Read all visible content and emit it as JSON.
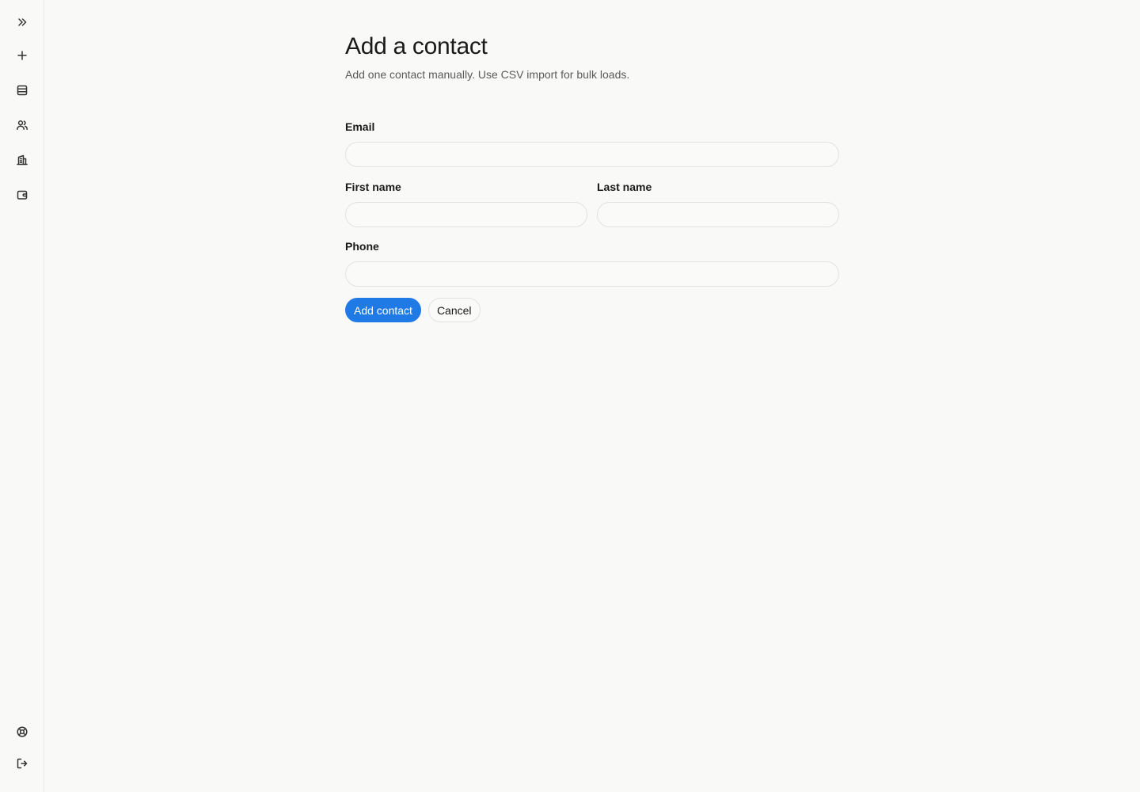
{
  "sidebar": {
    "top_items": [
      {
        "name": "expand-sidebar",
        "icon": "chevrons-right-icon"
      },
      {
        "name": "new",
        "icon": "plus-icon"
      },
      {
        "name": "lists",
        "icon": "table-icon"
      },
      {
        "name": "contacts",
        "icon": "users-icon"
      },
      {
        "name": "companies",
        "icon": "building-icon"
      },
      {
        "name": "wallet",
        "icon": "wallet-icon"
      }
    ],
    "bottom_items": [
      {
        "name": "help",
        "icon": "lifebuoy-icon"
      },
      {
        "name": "logout",
        "icon": "logout-icon"
      }
    ]
  },
  "page": {
    "title": "Add a contact",
    "subtitle": "Add one contact manually. Use CSV import for bulk loads."
  },
  "form": {
    "email": {
      "label": "Email",
      "value": "",
      "placeholder": ""
    },
    "first_name": {
      "label": "First name",
      "value": "",
      "placeholder": ""
    },
    "last_name": {
      "label": "Last name",
      "value": "",
      "placeholder": ""
    },
    "phone": {
      "label": "Phone",
      "value": "",
      "placeholder": ""
    }
  },
  "actions": {
    "submit_label": "Add contact",
    "cancel_label": "Cancel"
  },
  "colors": {
    "accent": "#1f7ae6",
    "background": "#f9f9f7",
    "border": "#e2e2de"
  }
}
